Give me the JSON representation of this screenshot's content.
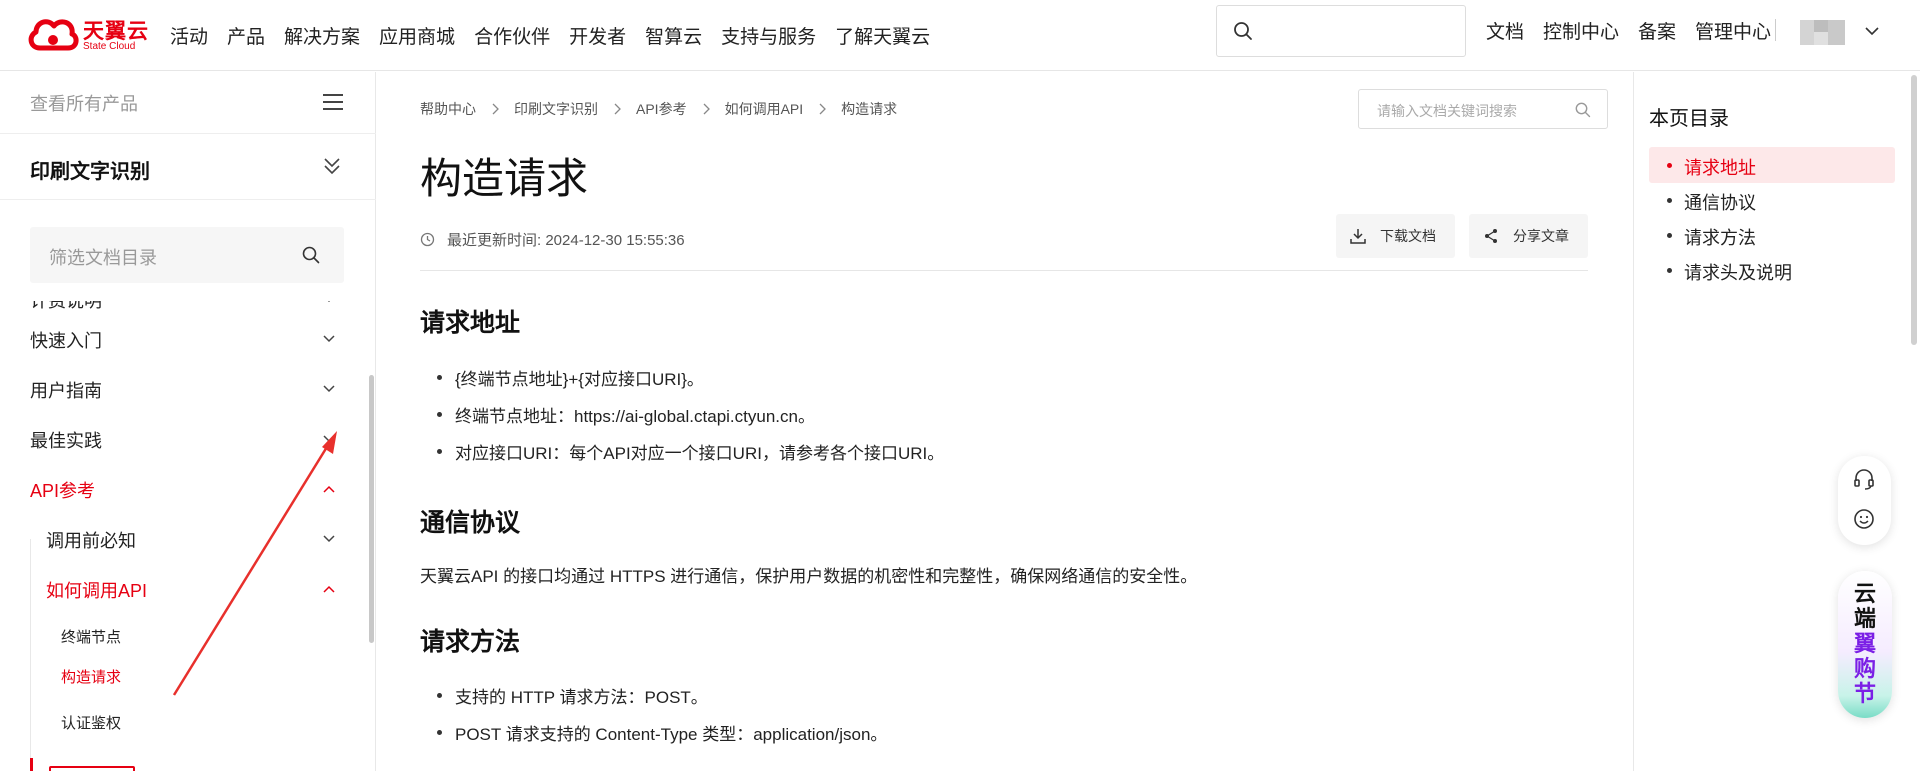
{
  "header": {
    "logo_cn": "天翼云",
    "logo_en": "State Cloud",
    "nav": [
      "活动",
      "产品",
      "解决方案",
      "应用商城",
      "合作伙伴",
      "开发者",
      "智算云",
      "支持与服务",
      "了解天翼云"
    ],
    "links": [
      "文档",
      "控制中心",
      "备案",
      "管理中心"
    ],
    "icons": {
      "search": "search-icon",
      "user_menu": "chevron-down-icon"
    }
  },
  "sidebar": {
    "all_products": "查看所有产品",
    "product": "印刷文字识别",
    "filter_placeholder": "筛选文档目录",
    "tree": [
      {
        "label": "计费说明"
      },
      {
        "label": "快速入门"
      },
      {
        "label": "用户指南"
      },
      {
        "label": "最佳实践"
      },
      {
        "label": "API参考"
      },
      {
        "label": "调用前必知"
      },
      {
        "label": "如何调用API"
      },
      {
        "label": "终端节点"
      },
      {
        "label": "构造请求"
      },
      {
        "label": "认证鉴权"
      }
    ]
  },
  "main": {
    "breadcrumb": [
      "帮助中心",
      "印刷文字识别",
      "API参考",
      "如何调用API",
      "构造请求"
    ],
    "doc_search_placeholder": "请输入文档关键词搜索",
    "title": "构造请求",
    "updated": "最近更新时间: 2024-12-30 15:55:36",
    "download": "下载文档",
    "share": "分享文章",
    "sections": {
      "s1": {
        "heading": "请求地址",
        "bullets": [
          "{终端节点地址}+{对应接口URI}。",
          "终端节点地址：https://ai-global.ctapi.ctyun.cn。",
          "对应接口URI：每个API对应一个接口URI，请参考各个接口URI。"
        ]
      },
      "s2": {
        "heading": "通信协议",
        "text": "天翼云API 的接口均通过 HTTPS 进行通信，保护用户数据的机密性和完整性，确保网络通信的安全性。"
      },
      "s3": {
        "heading": "请求方法",
        "bullets": [
          "支持的 HTTP 请求方法：POST。",
          "POST 请求支持的 Content-Type 类型：application/json。"
        ]
      }
    }
  },
  "toc": {
    "title": "本页目录",
    "items": [
      "请求地址",
      "通信协议",
      "请求方法",
      "请求头及说明"
    ]
  },
  "promo": {
    "chars": [
      "云",
      "端",
      "翼",
      "购",
      "节"
    ]
  },
  "colors": {
    "brand": "#e60012",
    "active_bg": "#fde8e9",
    "promo_accent": "#7b1fe6"
  }
}
